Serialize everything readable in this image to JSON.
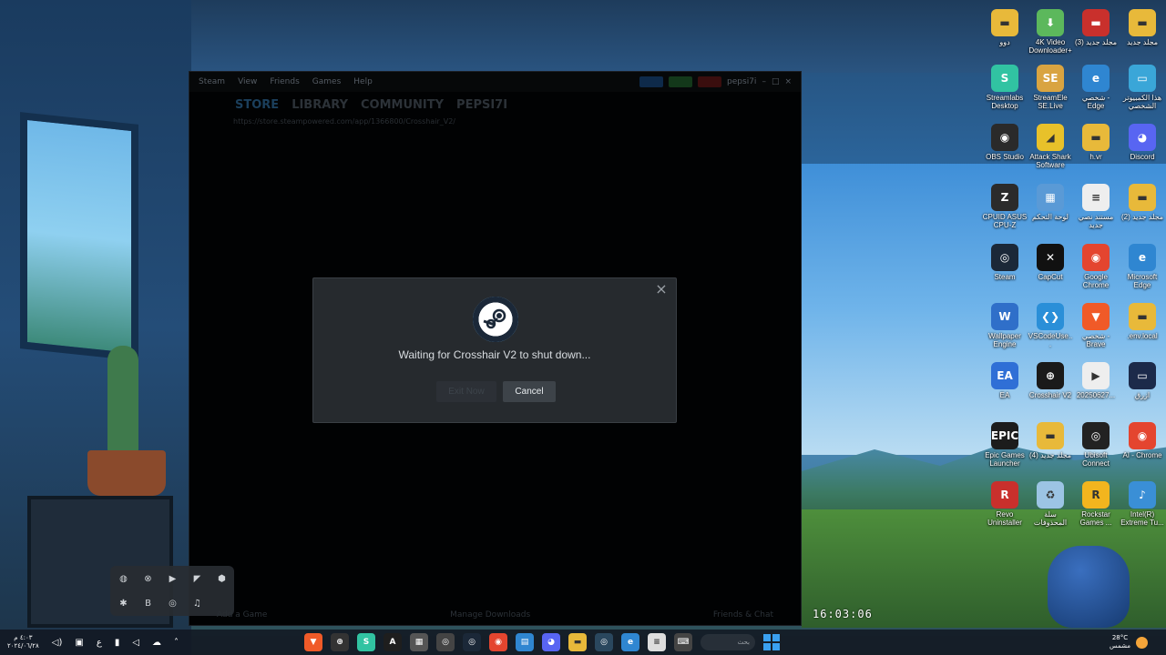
{
  "steam": {
    "menu": [
      "Steam",
      "View",
      "Friends",
      "Games",
      "Help"
    ],
    "account_chip": "pepsi7i",
    "nav": [
      "STORE",
      "LIBRARY",
      "COMMUNITY",
      "PEPSI7I"
    ],
    "url": "https://store.steampowered.com/app/1366800/Crosshair_V2/",
    "footer_left": "Add a Game",
    "footer_center": "Manage Downloads",
    "footer_right": "Friends & Chat"
  },
  "dialog": {
    "message": "Waiting for Crosshair V2 to shut down...",
    "exit_label": "Exit Now",
    "cancel_label": "Cancel",
    "close_glyph": "×"
  },
  "desktop_icons": [
    {
      "label": "دوو",
      "icon": "folder-icon",
      "color": "#e8b93a",
      "glyph": "▬"
    },
    {
      "label": "4K Video Downloader+",
      "icon": "4k-downloader-icon",
      "color": "#5cb85c",
      "glyph": "⬇"
    },
    {
      "label": "(3) مجلد جديد",
      "icon": "folder-icon",
      "color": "#c9302c",
      "glyph": "▬"
    },
    {
      "label": "مجلد جديد",
      "icon": "folder-icon",
      "color": "#e8b93a",
      "glyph": "▬"
    },
    {
      "label": "Streamlabs Desktop",
      "icon": "streamlabs-icon",
      "color": "#31c3a2",
      "glyph": "S"
    },
    {
      "label": "StreamEle SE.Live",
      "icon": "streamelements-icon",
      "color": "#d9a441",
      "glyph": "SE"
    },
    {
      "label": "شخصي - Edge",
      "icon": "edge-icon",
      "color": "#2f86d1",
      "glyph": "e"
    },
    {
      "label": "هذا الكمبيوتر الشخصي",
      "icon": "this-pc-icon",
      "color": "#3aa6d8",
      "glyph": "▭"
    },
    {
      "label": "OBS Studio",
      "icon": "obs-icon",
      "color": "#2a2a2a",
      "glyph": "◉"
    },
    {
      "label": "Attack Shark Software",
      "icon": "attack-shark-icon",
      "color": "#e8c12a",
      "glyph": "◢"
    },
    {
      "label": "h.vr",
      "icon": "folder-icon",
      "color": "#e8b93a",
      "glyph": "▬"
    },
    {
      "label": "Discord",
      "icon": "discord-icon",
      "color": "#5865f2",
      "glyph": "◕"
    },
    {
      "label": "CPUID ASUS CPU-Z",
      "icon": "cpuz-icon",
      "color": "#2b2b2b",
      "glyph": "Z"
    },
    {
      "label": "لوحة التحكم",
      "icon": "control-panel-icon",
      "color": "#5a9ad6",
      "glyph": "▦"
    },
    {
      "label": "مستند نصي جديد",
      "icon": "text-document-icon",
      "color": "#eeeeee",
      "glyph": "≡"
    },
    {
      "label": "(2) مجلد جديد",
      "icon": "folder-icon",
      "color": "#e8b93a",
      "glyph": "▬"
    },
    {
      "label": "Steam",
      "icon": "steam-icon",
      "color": "#1b2838",
      "glyph": "◎"
    },
    {
      "label": "CapCut",
      "icon": "capcut-icon",
      "color": "#111111",
      "glyph": "✕"
    },
    {
      "label": "Google Chrome",
      "icon": "chrome-icon",
      "color": "#e4452f",
      "glyph": "◉"
    },
    {
      "label": "Microsoft Edge",
      "icon": "edge-icon",
      "color": "#2f86d1",
      "glyph": "e"
    },
    {
      "label": "Wallpaper Engine",
      "icon": "wallpaper-engine-icon",
      "color": "#2f6fc9",
      "glyph": "W"
    },
    {
      "label": "VSCodeUse...",
      "icon": "vscode-icon",
      "color": "#2a8fd8",
      "glyph": "❮❯"
    },
    {
      "label": "شخصي - Brave",
      "icon": "brave-icon",
      "color": "#f05a28",
      "glyph": "▼"
    },
    {
      "label": ".env.local",
      "icon": "folder-icon",
      "color": "#e8b93a",
      "glyph": "▬"
    },
    {
      "label": "EA",
      "icon": "ea-icon",
      "color": "#2f6fd6",
      "glyph": "EA"
    },
    {
      "label": "Crosshair V2",
      "icon": "crosshair-icon",
      "color": "#1a1a1a",
      "glyph": "⊕"
    },
    {
      "label": "20250627...",
      "icon": "video-file-icon",
      "color": "#eeeeee",
      "glyph": "▶"
    },
    {
      "label": "ازرق",
      "icon": "image-file-icon",
      "color": "#1c2a4a",
      "glyph": "▭"
    },
    {
      "label": "Epic Games Launcher",
      "icon": "epic-games-icon",
      "color": "#1c1c1c",
      "glyph": "EPIC"
    },
    {
      "label": "(4) مجلد جديد",
      "icon": "folder-icon",
      "color": "#e8b93a",
      "glyph": "▬"
    },
    {
      "label": "Ubisoft Connect",
      "icon": "ubisoft-icon",
      "color": "#222222",
      "glyph": "◎"
    },
    {
      "label": "AI - Chrome",
      "icon": "chrome-icon",
      "color": "#e4452f",
      "glyph": "◉"
    },
    {
      "label": "Revo Uninstaller",
      "icon": "revo-uninstaller-icon",
      "color": "#c9302c",
      "glyph": "R"
    },
    {
      "label": "سلة المحذوفات",
      "icon": "recycle-bin-icon",
      "color": "#9cc4e4",
      "glyph": "♻"
    },
    {
      "label": "Rockstar Games ...",
      "icon": "rockstar-icon",
      "color": "#f2b51e",
      "glyph": "R"
    },
    {
      "label": "Intel(R) Extreme Tu...",
      "icon": "intel-xtu-icon",
      "color": "#3a8fd6",
      "glyph": "♪"
    }
  ],
  "desk_clock": "16:03:06",
  "tray_popup": [
    {
      "icon": "tray-app-1-icon",
      "glyph": "◍"
    },
    {
      "icon": "tray-crosshair-icon",
      "glyph": "⊗"
    },
    {
      "icon": "tray-play-icon",
      "glyph": "▶"
    },
    {
      "icon": "tray-nvidia-icon",
      "glyph": "◤"
    },
    {
      "icon": "tray-shield-icon",
      "glyph": "⬢"
    },
    {
      "icon": "tray-bluetooth-icon",
      "glyph": "✱"
    },
    {
      "icon": "tray-b-icon",
      "glyph": "B"
    },
    {
      "icon": "tray-steam-icon",
      "glyph": "◎"
    },
    {
      "icon": "tray-headset-icon",
      "glyph": "♫"
    }
  ],
  "taskbar": {
    "time": "٤:٠٣ م",
    "date": "٢٠٢٤/٠٦/٢٨",
    "system": [
      {
        "icon": "volume-icon",
        "glyph": "◁)"
      },
      {
        "icon": "network-icon",
        "glyph": "▣"
      },
      {
        "icon": "language-icon",
        "glyph": "ع"
      },
      {
        "icon": "microphone-icon",
        "glyph": "▮"
      },
      {
        "icon": "speaker-icon",
        "glyph": "◁"
      },
      {
        "icon": "onedrive-icon",
        "glyph": "☁"
      },
      {
        "icon": "tray-chevron-icon",
        "glyph": "˄"
      }
    ],
    "apps": [
      {
        "icon": "brave-icon",
        "color": "#f05a28",
        "glyph": "▼"
      },
      {
        "icon": "crosshair-icon",
        "color": "#333333",
        "glyph": "⊕"
      },
      {
        "icon": "streamlabs-icon",
        "color": "#31c3a2",
        "glyph": "S"
      },
      {
        "icon": "app-a-icon",
        "color": "#1e1e1e",
        "glyph": "A"
      },
      {
        "icon": "calculator-icon",
        "color": "#555555",
        "glyph": "▦"
      },
      {
        "icon": "gamepad-icon",
        "color": "#444444",
        "glyph": "◎"
      },
      {
        "icon": "steam-icon",
        "color": "#1b2838",
        "glyph": "◎"
      },
      {
        "icon": "chrome-icon",
        "color": "#e4452f",
        "glyph": "◉"
      },
      {
        "icon": "store-icon",
        "color": "#2f86d1",
        "glyph": "▤"
      },
      {
        "icon": "discord-icon",
        "color": "#5865f2",
        "glyph": "◕"
      },
      {
        "icon": "file-explorer-icon",
        "color": "#e8b93a",
        "glyph": "▬"
      },
      {
        "icon": "steam-icon",
        "color": "#2a475e",
        "glyph": "◎"
      },
      {
        "icon": "edge-icon",
        "color": "#2f86d1",
        "glyph": "e"
      },
      {
        "icon": "notepad-icon",
        "color": "#dddddd",
        "glyph": "≡"
      },
      {
        "icon": "keyboard-icon",
        "color": "#444444",
        "glyph": "⌨"
      }
    ],
    "search_placeholder": "بحث",
    "weather_temp": "28°C",
    "weather_desc": "مشمس"
  }
}
